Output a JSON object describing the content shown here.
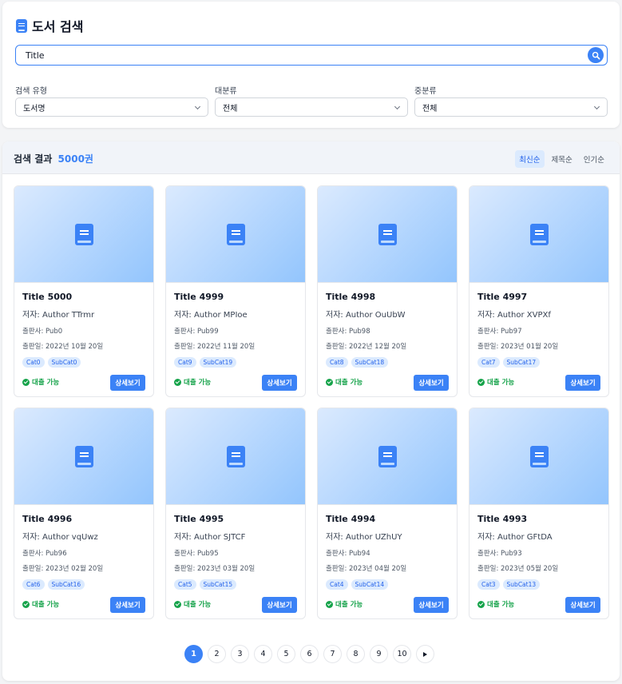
{
  "search_panel": {
    "title": "도서 검색",
    "search_value": "Title",
    "filters": [
      {
        "label": "검색 유형",
        "value": "도서명"
      },
      {
        "label": "대분류",
        "value": "전체"
      },
      {
        "label": "중분류",
        "value": "전체"
      }
    ]
  },
  "results": {
    "label": "검색 결과",
    "count": "5000권",
    "sort_options": [
      "최신순",
      "제목순",
      "인기순"
    ],
    "active_sort": "최신순",
    "books": [
      {
        "title": "Title 5000",
        "author": "저자: Author TTrmr",
        "publisher": "출판사: Pub0",
        "date": "출판일: 2022년 10월 20일",
        "cat": "Cat0",
        "subcat": "SubCat0",
        "status": "대출 가능",
        "button": "상세보기"
      },
      {
        "title": "Title 4999",
        "author": "저자: Author MPIoe",
        "publisher": "출판사: Pub99",
        "date": "출판일: 2022년 11월 20일",
        "cat": "Cat9",
        "subcat": "SubCat19",
        "status": "대출 가능",
        "button": "상세보기"
      },
      {
        "title": "Title 4998",
        "author": "저자: Author OuUbW",
        "publisher": "출판사: Pub98",
        "date": "출판일: 2022년 12월 20일",
        "cat": "Cat8",
        "subcat": "SubCat18",
        "status": "대출 가능",
        "button": "상세보기"
      },
      {
        "title": "Title 4997",
        "author": "저자: Author XVPXf",
        "publisher": "출판사: Pub97",
        "date": "출판일: 2023년 01월 20일",
        "cat": "Cat7",
        "subcat": "SubCat17",
        "status": "대출 가능",
        "button": "상세보기"
      },
      {
        "title": "Title 4996",
        "author": "저자: Author vqUwz",
        "publisher": "출판사: Pub96",
        "date": "출판일: 2023년 02월 20일",
        "cat": "Cat6",
        "subcat": "SubCat16",
        "status": "대출 가능",
        "button": "상세보기"
      },
      {
        "title": "Title 4995",
        "author": "저자: Author SJTCF",
        "publisher": "출판사: Pub95",
        "date": "출판일: 2023년 03월 20일",
        "cat": "Cat5",
        "subcat": "SubCat15",
        "status": "대출 가능",
        "button": "상세보기"
      },
      {
        "title": "Title 4994",
        "author": "저자: Author UZhUY",
        "publisher": "출판사: Pub94",
        "date": "출판일: 2023년 04월 20일",
        "cat": "Cat4",
        "subcat": "SubCat14",
        "status": "대출 가능",
        "button": "상세보기"
      },
      {
        "title": "Title 4993",
        "author": "저자: Author GFtDA",
        "publisher": "출판사: Pub93",
        "date": "출판일: 2023년 05월 20일",
        "cat": "Cat3",
        "subcat": "SubCat13",
        "status": "대출 가능",
        "button": "상세보기"
      }
    ]
  },
  "pagination": {
    "pages": [
      "1",
      "2",
      "3",
      "4",
      "5",
      "6",
      "7",
      "8",
      "9",
      "10"
    ],
    "current": "1",
    "next_icon": "chevron-right-icon"
  },
  "colors": {
    "accent": "#3b82f6",
    "available": "#16a34a"
  }
}
